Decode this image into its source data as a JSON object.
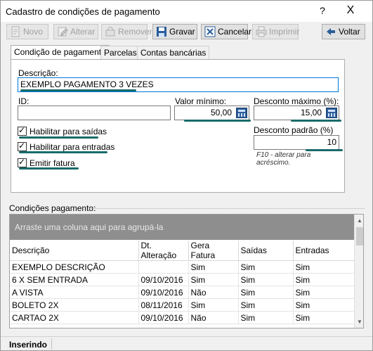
{
  "window": {
    "title": "Cadastro de condições de pagamento",
    "help_label": "?",
    "close_label": "X"
  },
  "toolbar": {
    "novo": "Novo",
    "alterar": "Alterar",
    "remover": "Remover",
    "gravar": "Gravar",
    "cancelar": "Cancelar",
    "imprimir": "Imprimir",
    "voltar": "Voltar"
  },
  "tabs": [
    "Condição de pagamento",
    "Parcelas",
    "Contas bancárias"
  ],
  "form": {
    "descricao_label": "Descrição:",
    "descricao_value": "EXEMPLO PAGAMENTO 3 VEZES",
    "id_label": "ID:",
    "id_value": "",
    "valor_minimo_label": "Valor mínimo:",
    "valor_minimo_value": "50,00",
    "desconto_maximo_label": "Desconto máximo (%):",
    "desconto_maximo_value": "15,00",
    "desconto_padrao_label": "Desconto padrão (%)",
    "desconto_padrao_value": "10",
    "hint": "F10 - alterar para acréscimo.",
    "chk_saidas": "Habilitar para saídas",
    "chk_entradas": "Habilitar para entradas",
    "chk_fatura": "Emitir fatura"
  },
  "grid": {
    "title": "Condições pagamento:",
    "group_hint": "Arraste uma coluna aqui para agrupá-la",
    "columns": [
      "Descrição",
      "Dt. Alteração",
      "Gera Fatura",
      "Saídas",
      "Entradas"
    ],
    "rows": [
      [
        "EXEMPLO DESCRIÇÃO",
        "",
        "Sim",
        "Sim",
        "Sim"
      ],
      [
        "6 X SEM ENTRADA",
        "09/10/2016",
        "Sim",
        "Sim",
        "Sim"
      ],
      [
        "A VISTA",
        "09/10/2016",
        "Não",
        "Sim",
        "Sim"
      ],
      [
        "BOLETO 2X",
        "08/11/2016",
        "Sim",
        "Sim",
        "Sim"
      ],
      [
        "CARTAO 2X",
        "09/10/2016",
        "Não",
        "Sim",
        "Sim"
      ]
    ]
  },
  "status": {
    "mode": "Inserindo"
  },
  "colors": {
    "annotation": "#1a6b6b",
    "focus": "#0078d7",
    "group_bar": "#8e8e8e"
  }
}
